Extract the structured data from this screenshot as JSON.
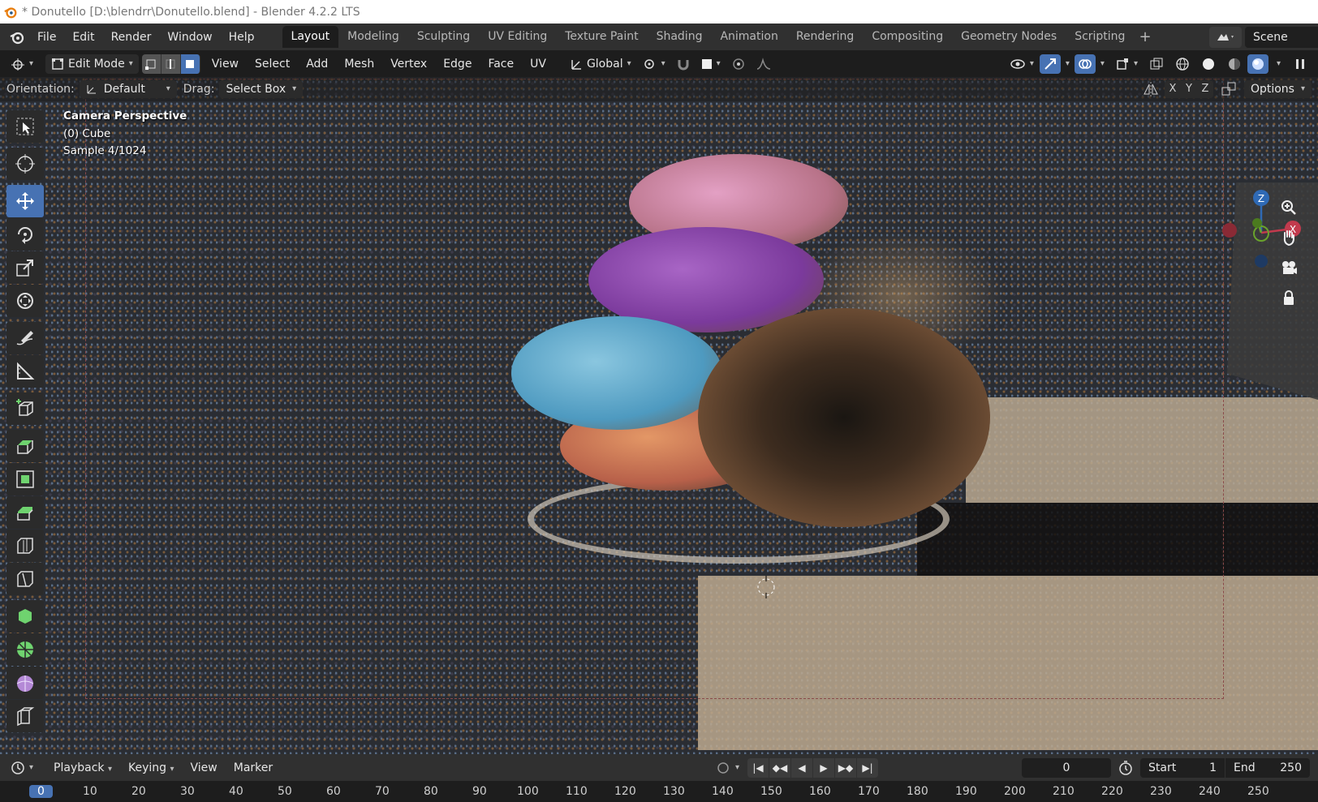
{
  "window": {
    "title": "* Donutello [D:\\blendrr\\Donutello.blend] - Blender 4.2.2 LTS"
  },
  "menu": [
    "File",
    "Edit",
    "Render",
    "Window",
    "Help"
  ],
  "workspaces": [
    "Layout",
    "Modeling",
    "Sculpting",
    "UV Editing",
    "Texture Paint",
    "Shading",
    "Animation",
    "Rendering",
    "Compositing",
    "Geometry Nodes",
    "Scripting"
  ],
  "scene": {
    "name": "Scene"
  },
  "header": {
    "mode": "Edit Mode",
    "menus": [
      "View",
      "Select",
      "Add",
      "Mesh",
      "Vertex",
      "Edge",
      "Face",
      "UV"
    ],
    "transform_orientation": "Global"
  },
  "tool_header": {
    "orientation_label": "Orientation:",
    "orientation_value": "Default",
    "drag_label": "Drag:",
    "drag_value": "Select Box",
    "axes": [
      "X",
      "Y",
      "Z"
    ],
    "options": "Options"
  },
  "viewport": {
    "overlay_lines": [
      "Camera Perspective",
      "(0) Cube",
      "Sample 4/1024"
    ]
  },
  "tools": [
    "select-box-icon",
    "cursor-icon",
    "move-icon",
    "rotate-icon",
    "scale-icon",
    "transform-icon",
    "annotate-icon",
    "measure-icon",
    "add-cube-icon",
    "extrude-icon",
    "inset-icon",
    "bevel-icon",
    "loop-cut-icon",
    "knife-icon",
    "poly-build-icon",
    "spin-icon",
    "smooth-icon",
    "shear-icon"
  ],
  "gizmo": {
    "z": "Z",
    "x": "X"
  },
  "timeline": {
    "menus": [
      "Playback",
      "Keying",
      "View",
      "Marker"
    ],
    "current_frame": "0",
    "start_label": "Start",
    "start_value": "1",
    "end_label": "End",
    "end_value": "250",
    "ruler_current": "0",
    "ruler": [
      "10",
      "20",
      "30",
      "40",
      "50",
      "60",
      "70",
      "80",
      "90",
      "100",
      "110",
      "120",
      "130",
      "140",
      "150",
      "160",
      "170",
      "180",
      "190",
      "200",
      "210",
      "220",
      "230",
      "240",
      "250"
    ]
  },
  "colors": {
    "accent": "#4772b3",
    "bg": "#1d1d1d",
    "panel": "#303030"
  }
}
